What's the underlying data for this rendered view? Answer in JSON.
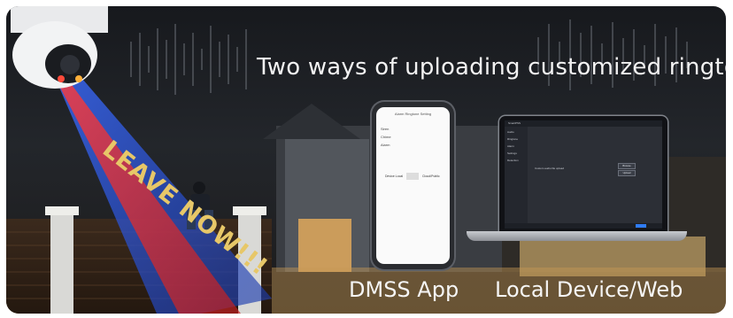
{
  "banner": {
    "headline": "Two ways of uploading customized ringtone:",
    "warning_text": "LEAVE NOW!!!",
    "label_app": "DMSS App",
    "label_web": "Local Device/Web"
  },
  "phone": {
    "title": "Alarm Ringtone Setting",
    "options": [
      "Siren",
      "Chime",
      "Alarm"
    ],
    "device_local_label": "Device Local",
    "cloud_label": "Cloud/Public"
  },
  "laptop": {
    "app_name": "SmartPSS",
    "sidebar_items": [
      "Audio",
      "Ringtone",
      "Alarm",
      "Settings",
      "Detection"
    ],
    "buttons": [
      "Browse",
      "Upload"
    ],
    "status_text": "Custom audio file upload"
  },
  "colors": {
    "headline": "#f2f2f2",
    "warning": "#e7c768",
    "beam_blue": "#2f5fe0",
    "beam_red": "#e03030"
  }
}
